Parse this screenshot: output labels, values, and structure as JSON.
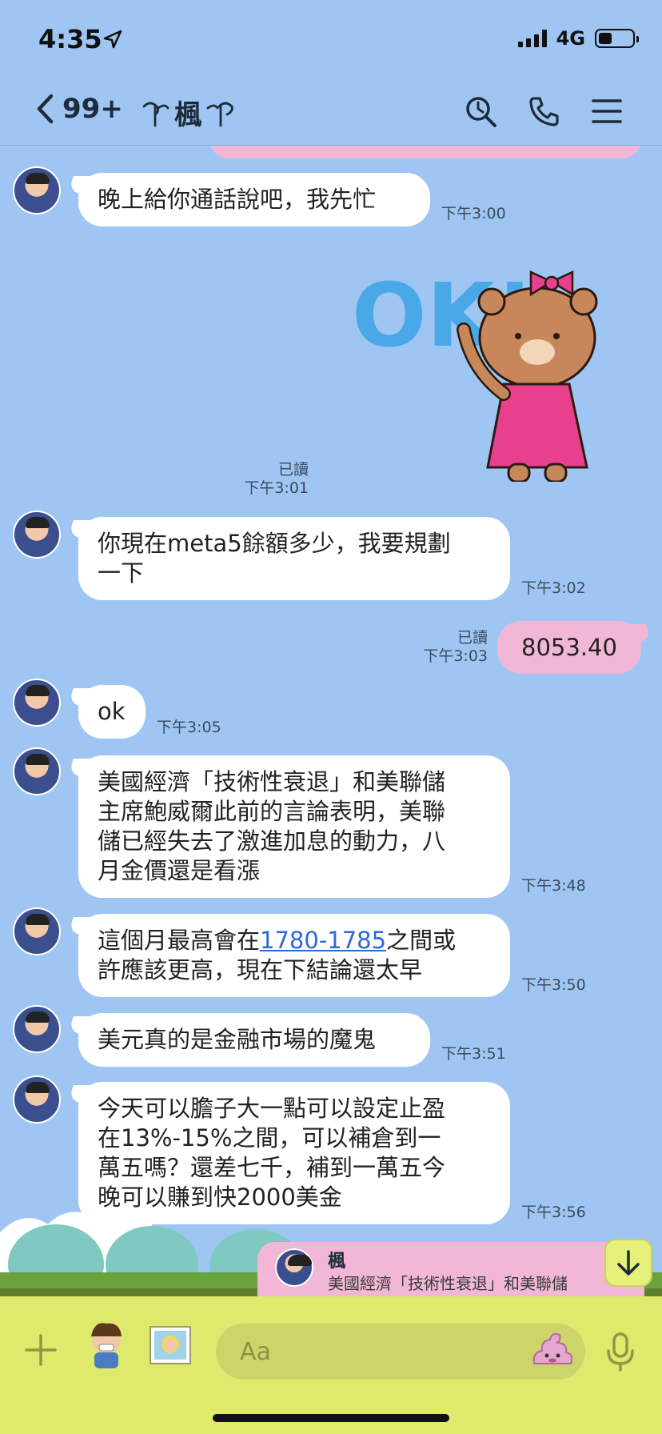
{
  "status_bar": {
    "time": "4:35",
    "network": "4G",
    "battery_level": 0.4
  },
  "header": {
    "back_count": "99+",
    "title": "楓"
  },
  "messages": [
    {
      "text": "晚上給你通話說吧，我先忙",
      "time": "下午3:00"
    },
    {
      "read": "已讀",
      "time": "下午3:01"
    },
    {
      "text": "你現在meta5餘額多少，我要規劃一下",
      "line1": "你現在meta5餘額多少，我要規劃",
      "line2": "一下",
      "time": "下午3:02"
    },
    {
      "text": "8053.40",
      "read": "已讀",
      "time": "下午3:03"
    },
    {
      "text": "ok",
      "time": "下午3:05"
    },
    {
      "line1": "美國經濟「技術性衰退」和美聯儲",
      "line2": "主席鮑威爾此前的言論表明，美聯",
      "line3": "儲已經失去了激進加息的動力，八",
      "line4": "月金價還是看漲",
      "time": "下午3:48"
    },
    {
      "line1_pre": "這個月最高會在",
      "link": "1780-1785",
      "line1_post": "之間或",
      "line2": "許應該更高，現在下結論還太早",
      "time": "下午3:50"
    },
    {
      "text": "美元真的是金融市場的魔鬼",
      "time": "下午3:51"
    },
    {
      "line1": "今天可以膽子大一點可以設定止盈",
      "line2": "在13%-15%之間，可以補倉到一",
      "line3": "萬五嗎？還差七千，補到一萬五今",
      "line4": "晚可以賺到快2000美金",
      "time": "下午3:56"
    }
  ],
  "preview": {
    "name": "楓",
    "text": "美國經濟「技術性衰退」和美聯儲"
  },
  "input": {
    "placeholder": "Aa"
  },
  "colors": {
    "background": "#9fc6f2",
    "outgoing_bubble": "#f2b7d6",
    "incoming_bubble": "#ffffff",
    "input_bar": "#dfe96c",
    "link": "#2b6ad8"
  }
}
